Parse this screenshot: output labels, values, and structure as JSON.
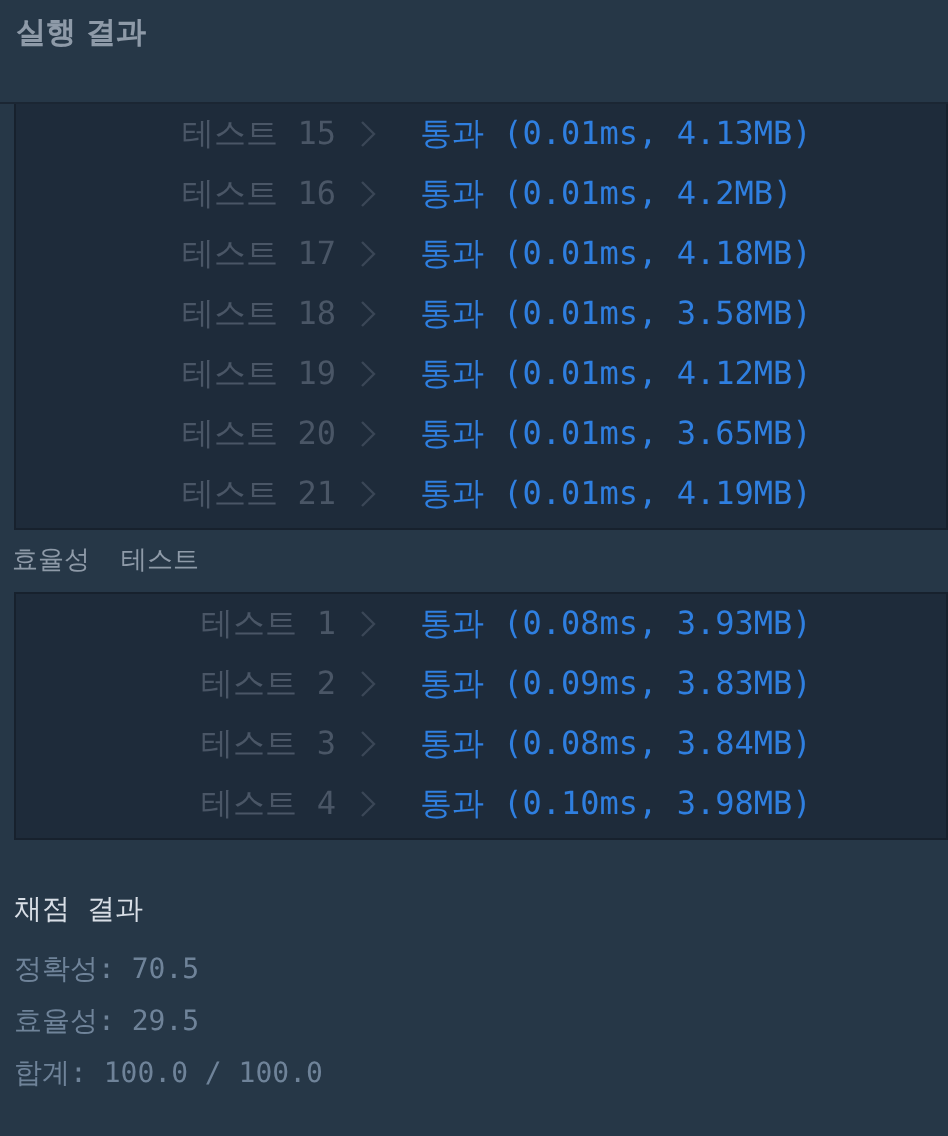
{
  "header": {
    "title": "실행 결과"
  },
  "sections": [
    {
      "rows": [
        {
          "label": "테스트 15",
          "result": "통과 (0.01ms, 4.13MB)"
        },
        {
          "label": "테스트 16",
          "result": "통과 (0.01ms, 4.2MB)"
        },
        {
          "label": "테스트 17",
          "result": "통과 (0.01ms, 4.18MB)"
        },
        {
          "label": "테스트 18",
          "result": "통과 (0.01ms, 3.58MB)"
        },
        {
          "label": "테스트 19",
          "result": "통과 (0.01ms, 4.12MB)"
        },
        {
          "label": "테스트 20",
          "result": "통과 (0.01ms, 3.65MB)"
        },
        {
          "label": "테스트 21",
          "result": "통과 (0.01ms, 4.19MB)"
        }
      ]
    },
    {
      "title": "효율성  테스트",
      "rows": [
        {
          "label": "테스트 1",
          "result": "통과 (0.08ms, 3.93MB)"
        },
        {
          "label": "테스트 2",
          "result": "통과 (0.09ms, 3.83MB)"
        },
        {
          "label": "테스트 3",
          "result": "통과 (0.08ms, 3.84MB)"
        },
        {
          "label": "테스트 4",
          "result": "통과 (0.10ms, 3.98MB)"
        }
      ]
    }
  ],
  "grading": {
    "title": "채점 결과",
    "lines": [
      "정확성: 70.5",
      "효율성: 29.5",
      "합계: 100.0 / 100.0"
    ]
  }
}
